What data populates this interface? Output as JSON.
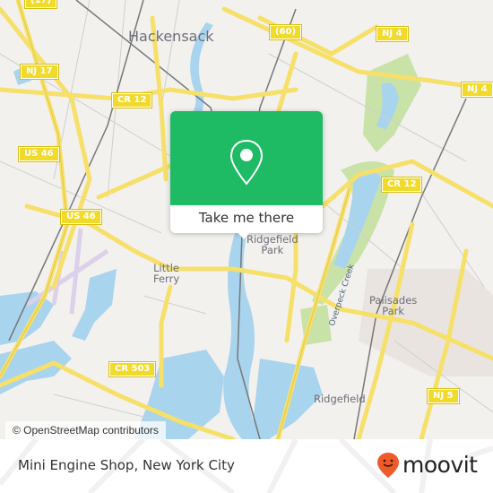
{
  "map": {
    "place_labels": [
      {
        "name": "Hackensack",
        "size": "big"
      },
      {
        "name": "Little\nFerry",
        "size": "mid"
      },
      {
        "name": "Ridgefield\nPark",
        "size": "mid"
      },
      {
        "name": "Palisades\nPark",
        "size": "mid"
      },
      {
        "name": "Ridgefield",
        "size": "mid"
      }
    ],
    "water_labels": [
      "Overpeck Creek"
    ],
    "road_shields": [
      "(17)",
      "(60)",
      "NJ 4",
      "NJ 4",
      "NJ 17",
      "CR 12",
      "CR 12",
      "US 46",
      "US 46",
      "CR 503",
      "NJ 5"
    ],
    "attribution": "© OpenStreetMap contributors",
    "colors": {
      "land": "#f2f1ee",
      "water": "#a9d4ee",
      "park": "#c9e2a8",
      "road": "#f6e06a",
      "rail": "#777777"
    }
  },
  "popup": {
    "pin_icon": "map-pin-icon",
    "action_label": "Take me there",
    "color": "#1eba64"
  },
  "footer": {
    "title": "Mini Engine Shop, New York City",
    "logo_text": "moovit",
    "logo_color": "#f05a28"
  }
}
